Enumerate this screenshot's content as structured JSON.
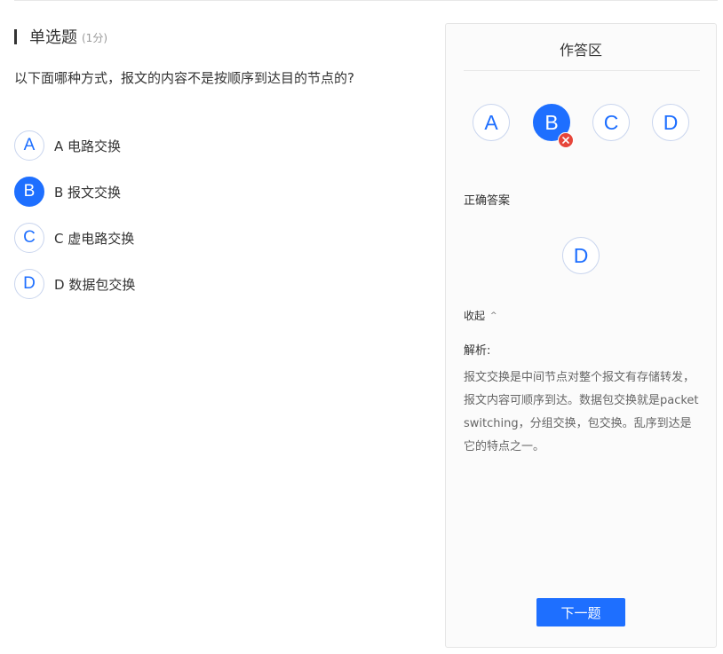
{
  "question": {
    "type": "单选题",
    "score": "(1分)",
    "text": "以下面哪种方式，报文的内容不是按顺序到达目的节点的?"
  },
  "options": [
    {
      "letter": "A",
      "label": "A 电路交换",
      "selected": false
    },
    {
      "letter": "B",
      "label": "B 报文交换",
      "selected": true
    },
    {
      "letter": "C",
      "label": "C 虚电路交换",
      "selected": false
    },
    {
      "letter": "D",
      "label": "D 数据包交换",
      "selected": false
    }
  ],
  "answer_panel": {
    "title": "作答区",
    "choices": [
      "A",
      "B",
      "C",
      "D"
    ],
    "user_answer": "B",
    "user_answer_status": "wrong",
    "correct_label": "正确答案",
    "correct_answer": "D",
    "collapse_label": "收起",
    "analysis_title": "解析:",
    "analysis_text": "报文交换是中间节点对整个报文有存储转发，报文内容可顺序到达。数据包交换就是packet switching，分组交换，包交换。乱序到达是它的特点之一。",
    "next_label": "下一题"
  },
  "colors": {
    "accent": "#1e6fff",
    "wrong": "#e6453a"
  }
}
